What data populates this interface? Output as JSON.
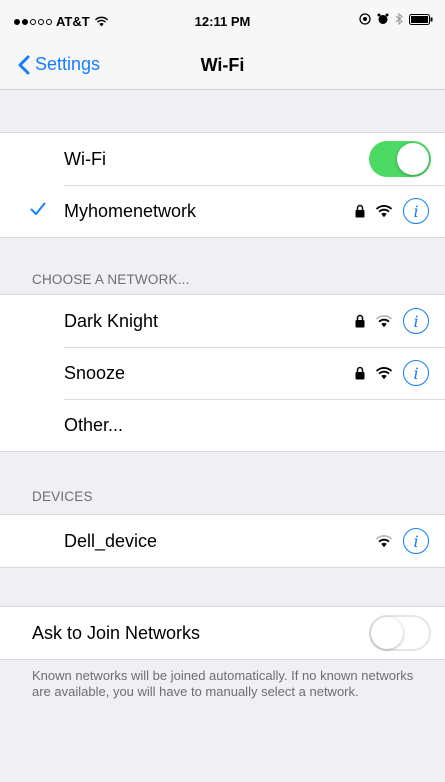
{
  "status_bar": {
    "carrier": "AT&T",
    "time": "12:11 PM",
    "signal_filled": 2,
    "signal_total": 5
  },
  "nav": {
    "back_label": "Settings",
    "title": "Wi-Fi"
  },
  "wifi_toggle": {
    "label": "Wi-Fi",
    "on": true
  },
  "connected": {
    "name": "Myhomenetwork",
    "secured": true
  },
  "choose_section": {
    "header": "CHOOSE A NETWORK...",
    "networks": [
      {
        "name": "Dark Knight",
        "secured": true
      },
      {
        "name": "Snooze",
        "secured": true
      }
    ],
    "other_label": "Other..."
  },
  "devices_section": {
    "header": "DEVICES",
    "devices": [
      {
        "name": "Dell_device",
        "secured": false
      }
    ]
  },
  "ask_to_join": {
    "label": "Ask to Join Networks",
    "on": false,
    "footer": "Known networks will be joined automatically. If no known networks are available, you will have to manually select a network."
  },
  "colors": {
    "accent": "#157efb",
    "toggle_on": "#4cd964",
    "background": "#efeff4"
  },
  "icons": {
    "info": "i",
    "lock": "lock-icon",
    "wifi": "wifi-icon",
    "check": "checkmark-icon"
  }
}
